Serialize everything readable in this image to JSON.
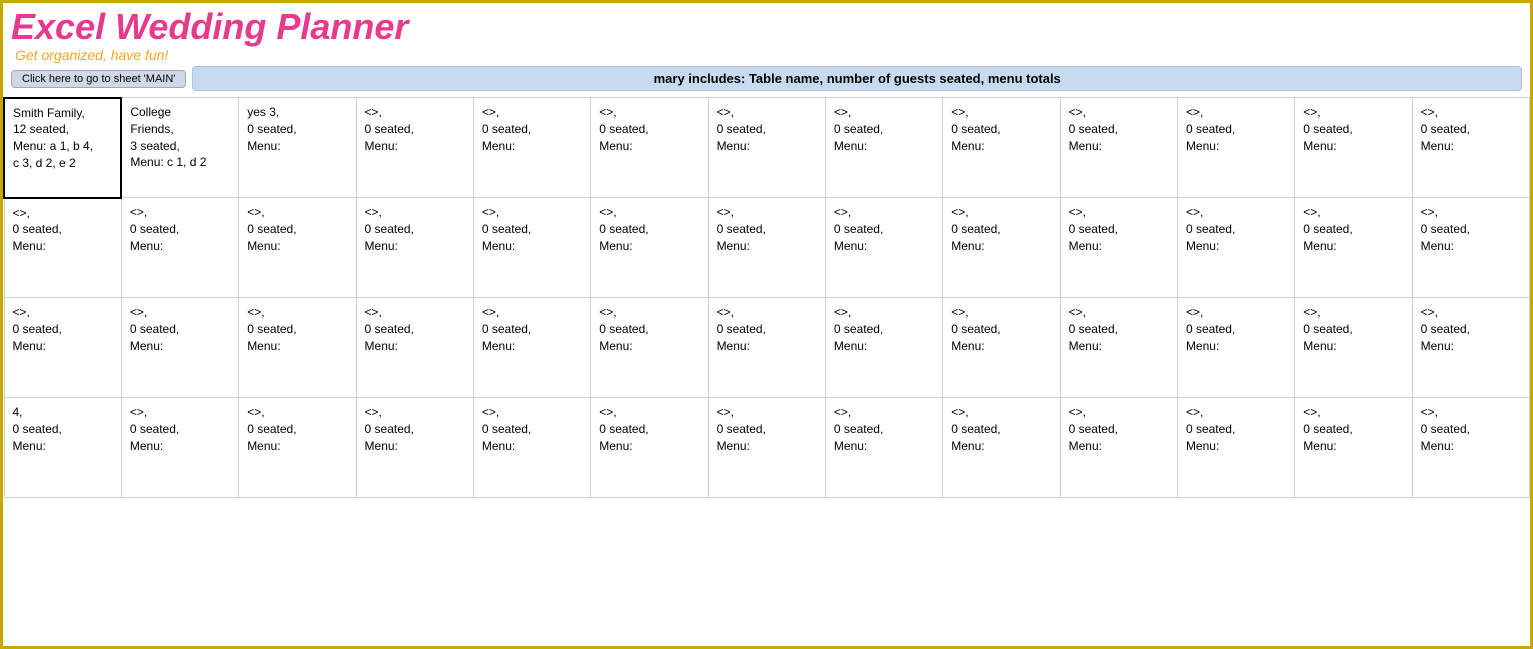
{
  "header": {
    "title": "Excel Wedding Planner",
    "subtitle": "Get organized, have fun!",
    "nav_button": "Click here to go to sheet 'MAIN'",
    "info_bar": "mary includes:  Table name, number of guests seated, menu totals"
  },
  "grid": {
    "rows": [
      [
        {
          "text": "Smith Family,\n12 seated,\nMenu: a 1, b 4,\nc 3, d 2, e 2",
          "highlighted": true
        },
        {
          "text": "College\nFriends,\n3 seated,\nMenu: c 1, d 2"
        },
        {
          "text": "yes 3,\n0 seated,\nMenu:"
        },
        {
          "text": "<<blank>>,\n0 seated,\nMenu:"
        },
        {
          "text": "<<blank>>,\n0 seated,\nMenu:"
        },
        {
          "text": "<<blank>>,\n0 seated,\nMenu:"
        },
        {
          "text": "<<blank>>,\n0 seated,\nMenu:"
        },
        {
          "text": "<<blank>>,\n0 seated,\nMenu:"
        },
        {
          "text": "<<blank>>,\n0 seated,\nMenu:"
        },
        {
          "text": "<<blank>>,\n0 seated,\nMenu:"
        },
        {
          "text": "<<blank>>,\n0 seated,\nMenu:"
        },
        {
          "text": "<<blank>>,\n0 seated,\nMenu:"
        },
        {
          "text": "<<blank>>,\n0 seated,\nMenu:"
        }
      ],
      [
        {
          "text": "<<blank>>,\n0 seated,\nMenu:",
          "highlighted": false
        },
        {
          "text": "<<blank>>,\n0 seated,\nMenu:"
        },
        {
          "text": "<<blank>>,\n0 seated,\nMenu:"
        },
        {
          "text": "<<blank>>,\n0 seated,\nMenu:"
        },
        {
          "text": "<<blank>>,\n0 seated,\nMenu:"
        },
        {
          "text": "<<blank>>,\n0 seated,\nMenu:"
        },
        {
          "text": "<<blank>>,\n0 seated,\nMenu:"
        },
        {
          "text": "<<blank>>,\n0 seated,\nMenu:"
        },
        {
          "text": "<<blank>>,\n0 seated,\nMenu:"
        },
        {
          "text": "<<blank>>,\n0 seated,\nMenu:"
        },
        {
          "text": "<<blank>>,\n0 seated,\nMenu:"
        },
        {
          "text": "<<blank>>,\n0 seated,\nMenu:"
        },
        {
          "text": "<<blank>>,\n0 seated,\nMenu:"
        }
      ],
      [
        {
          "text": "<<blank>>,\n0 seated,\nMenu:"
        },
        {
          "text": "<<blank>>,\n0 seated,\nMenu:"
        },
        {
          "text": "<<blank>>,\n0 seated,\nMenu:"
        },
        {
          "text": "<<blank>>,\n0 seated,\nMenu:"
        },
        {
          "text": "<<blank>>,\n0 seated,\nMenu:"
        },
        {
          "text": "<<blank>>,\n0 seated,\nMenu:"
        },
        {
          "text": "<<blank>>,\n0 seated,\nMenu:"
        },
        {
          "text": "<<blank>>,\n0 seated,\nMenu:"
        },
        {
          "text": "<<blank>>,\n0 seated,\nMenu:"
        },
        {
          "text": "<<blank>>,\n0 seated,\nMenu:"
        },
        {
          "text": "<<blank>>,\n0 seated,\nMenu:"
        },
        {
          "text": "<<blank>>,\n0 seated,\nMenu:"
        },
        {
          "text": "<<blank>>,\n0 seated,\nMenu:"
        }
      ],
      [
        {
          "text": "4,\n0 seated,\nMenu:"
        },
        {
          "text": "<<blank>>,\n0 seated,\nMenu:"
        },
        {
          "text": "<<blank>>,\n0 seated,\nMenu:"
        },
        {
          "text": "<<blank>>,\n0 seated,\nMenu:"
        },
        {
          "text": "<<blank>>,\n0 seated,\nMenu:"
        },
        {
          "text": "<<blank>>,\n0 seated,\nMenu:"
        },
        {
          "text": "<<blank>>,\n0 seated,\nMenu:"
        },
        {
          "text": "<<blank>>,\n0 seated,\nMenu:"
        },
        {
          "text": "<<blank>>,\n0 seated,\nMenu:"
        },
        {
          "text": "<<blank>>,\n0 seated,\nMenu:"
        },
        {
          "text": "<<blank>>,\n0 seated,\nMenu:"
        },
        {
          "text": "<<blank>>,\n0 seated,\nMenu:"
        },
        {
          "text": "<<blank>>,\n0 seated,\nMenu:"
        }
      ]
    ]
  }
}
